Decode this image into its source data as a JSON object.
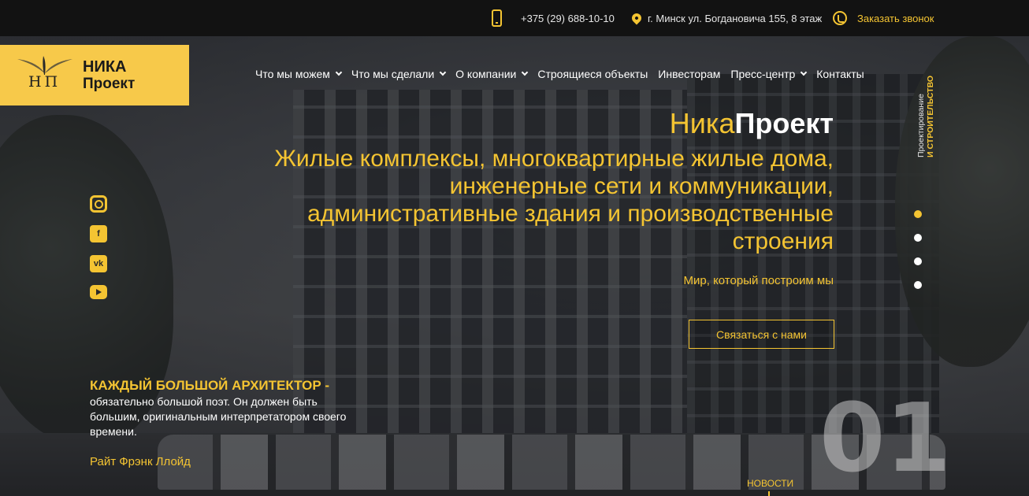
{
  "topbar": {
    "phone": "+375 (29) 688-10-10",
    "address": "г. Минск ул. Богдановича 155, 8 этаж",
    "callback": "Заказать звонок"
  },
  "logo": {
    "letters": "НП",
    "line1": "НИКА",
    "line2": "Проект"
  },
  "nav": {
    "items": [
      {
        "label": "Что мы можем",
        "has_dropdown": true
      },
      {
        "label": "Что мы сделали",
        "has_dropdown": true
      },
      {
        "label": "О компании",
        "has_dropdown": true
      },
      {
        "label": "Строящиеся объекты",
        "has_dropdown": false
      },
      {
        "label": "Инвесторам",
        "has_dropdown": false
      },
      {
        "label": "Пресс-центр",
        "has_dropdown": true
      },
      {
        "label": "Контакты",
        "has_dropdown": false
      }
    ]
  },
  "side_label": {
    "line1": "Проектирование",
    "line2": "И СТРОИТЕЛЬСТВО"
  },
  "hero": {
    "title_part1": "Ника",
    "title_part2": "Проект",
    "subtitle": "Жилые комплексы, многоквартирные жилые дома, инженерные сети и коммуникации, административные здания и производственные строения",
    "tagline": "Мир, который построим мы",
    "cta": "Связаться с нами"
  },
  "slider": {
    "slide_count": 4,
    "active_index": 0,
    "current_number": "01"
  },
  "socials": [
    "instagram-icon",
    "facebook-icon",
    "vk-icon",
    "youtube-icon"
  ],
  "quote": {
    "title": "КАЖДЫЙ БОЛЬШОЙ АРХИТЕКТОР -",
    "body": "обязательно большой поэт. Он должен быть большим, оригинальным интерпретатором своего времени.",
    "author": "Райт Фрэнк Ллойд"
  },
  "news": {
    "label": "НОВОСТИ"
  },
  "colors": {
    "accent": "#f4c432",
    "logo_bg": "#f7c94a",
    "topbar_bg": "#121212"
  }
}
